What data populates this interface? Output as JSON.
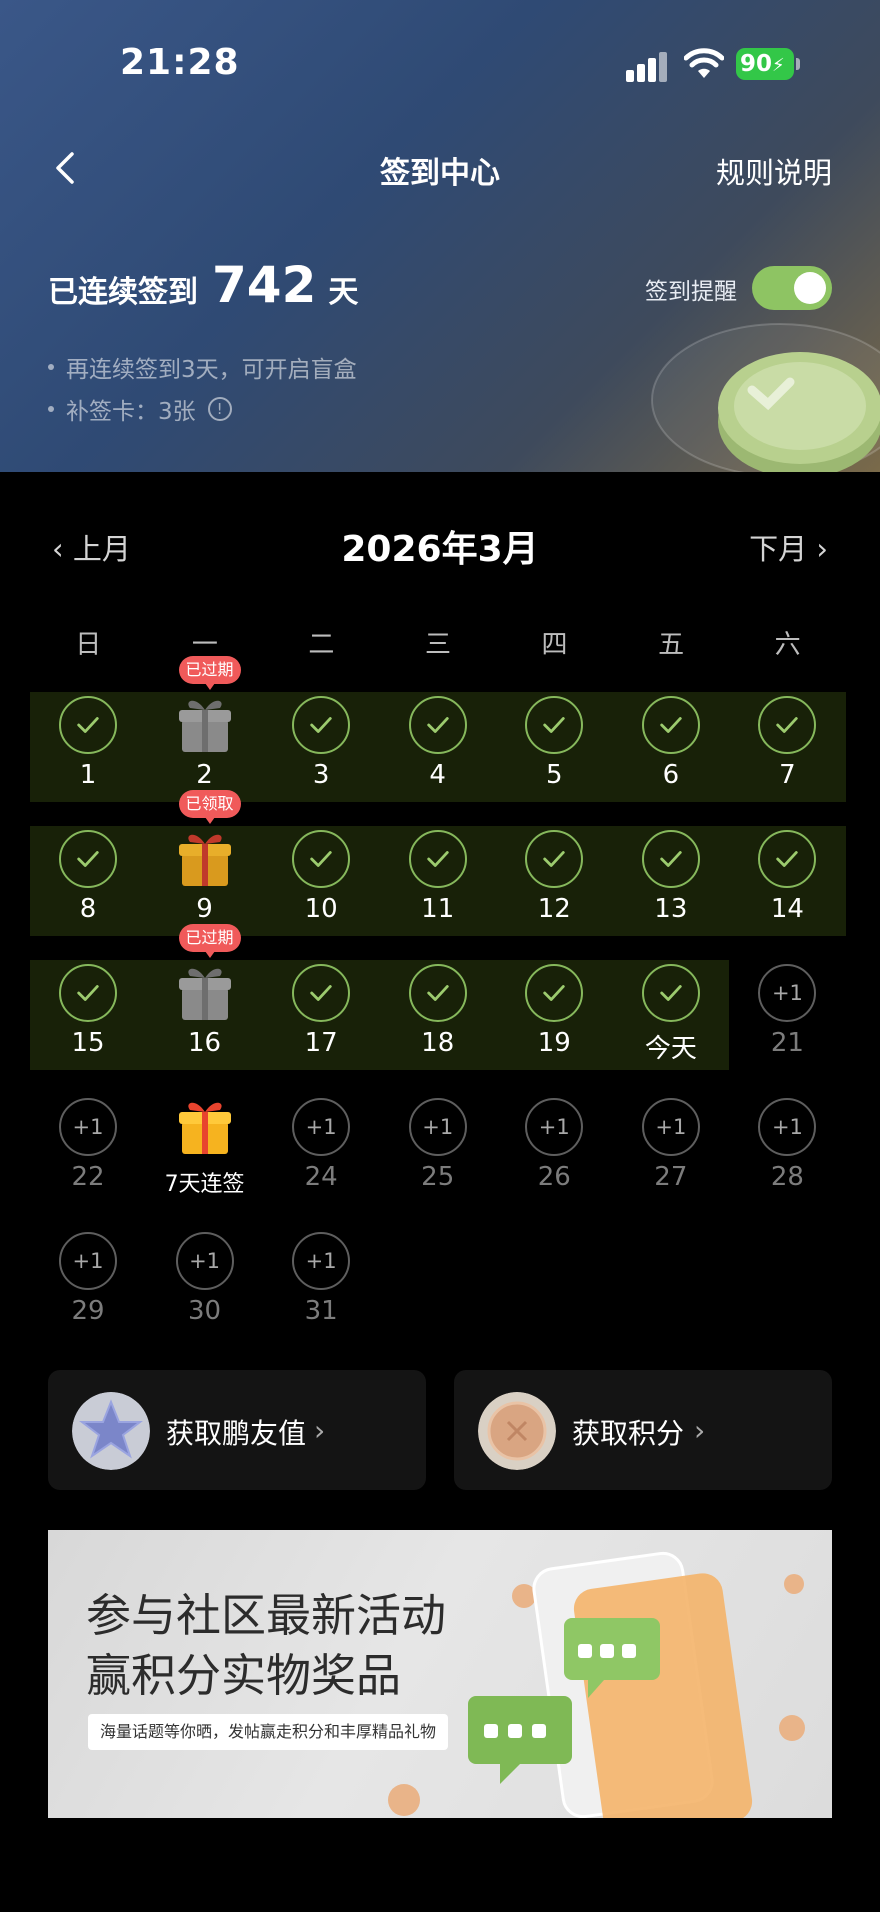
{
  "status_bar": {
    "time": "21:28",
    "battery": "90"
  },
  "header": {
    "title": "签到中心",
    "rules_label": "规则说明"
  },
  "streak": {
    "prefix": "已连续签到",
    "days": "742",
    "suffix": "天"
  },
  "reminder": {
    "label": "签到提醒",
    "enabled": true
  },
  "tips": [
    "再连续签到3天，可开启盲盒",
    "补签卡：3张"
  ],
  "calendar": {
    "month_title": "2026年3月",
    "prev_label": "上月",
    "next_label": "下月",
    "weekdays": [
      "日",
      "一",
      "二",
      "三",
      "四",
      "五",
      "六"
    ],
    "plus_label": "+1",
    "tags": {
      "expired": "已过期",
      "claimed": "已领取"
    },
    "special_labels": {
      "today": "今天",
      "streak7": "7天连签"
    },
    "days": [
      {
        "label": "1",
        "state": "checked"
      },
      {
        "label": "2",
        "state": "gift-gray",
        "tag": "已过期"
      },
      {
        "label": "3",
        "state": "checked"
      },
      {
        "label": "4",
        "state": "checked"
      },
      {
        "label": "5",
        "state": "checked"
      },
      {
        "label": "6",
        "state": "checked"
      },
      {
        "label": "7",
        "state": "checked"
      },
      {
        "label": "8",
        "state": "checked"
      },
      {
        "label": "9",
        "state": "gift-gold",
        "tag": "已领取"
      },
      {
        "label": "10",
        "state": "checked"
      },
      {
        "label": "11",
        "state": "checked"
      },
      {
        "label": "12",
        "state": "checked"
      },
      {
        "label": "13",
        "state": "checked"
      },
      {
        "label": "14",
        "state": "checked"
      },
      {
        "label": "15",
        "state": "checked"
      },
      {
        "label": "16",
        "state": "gift-gray",
        "tag": "已过期"
      },
      {
        "label": "17",
        "state": "checked"
      },
      {
        "label": "18",
        "state": "checked"
      },
      {
        "label": "19",
        "state": "checked"
      },
      {
        "label": "今天",
        "state": "checked"
      },
      {
        "label": "21",
        "state": "future"
      },
      {
        "label": "22",
        "state": "future"
      },
      {
        "label": "7天连签",
        "state": "gift-bright"
      },
      {
        "label": "24",
        "state": "future"
      },
      {
        "label": "25",
        "state": "future"
      },
      {
        "label": "26",
        "state": "future"
      },
      {
        "label": "27",
        "state": "future"
      },
      {
        "label": "28",
        "state": "future"
      },
      {
        "label": "29",
        "state": "future"
      },
      {
        "label": "30",
        "state": "future"
      },
      {
        "label": "31",
        "state": "future"
      }
    ]
  },
  "cards": [
    {
      "label": "获取鹏友值"
    },
    {
      "label": "获取积分"
    }
  ],
  "banner": {
    "title_line1": "参与社区最新活动",
    "title_line2": "赢积分实物奖品",
    "subtitle": "海量话题等你晒，发帖赢走积分和丰厚精品礼物"
  },
  "colors": {
    "accent_green": "#86b85c",
    "tag_red": "#f05a5a",
    "row_bg": "#182108",
    "toggle_green": "#8ec463"
  }
}
